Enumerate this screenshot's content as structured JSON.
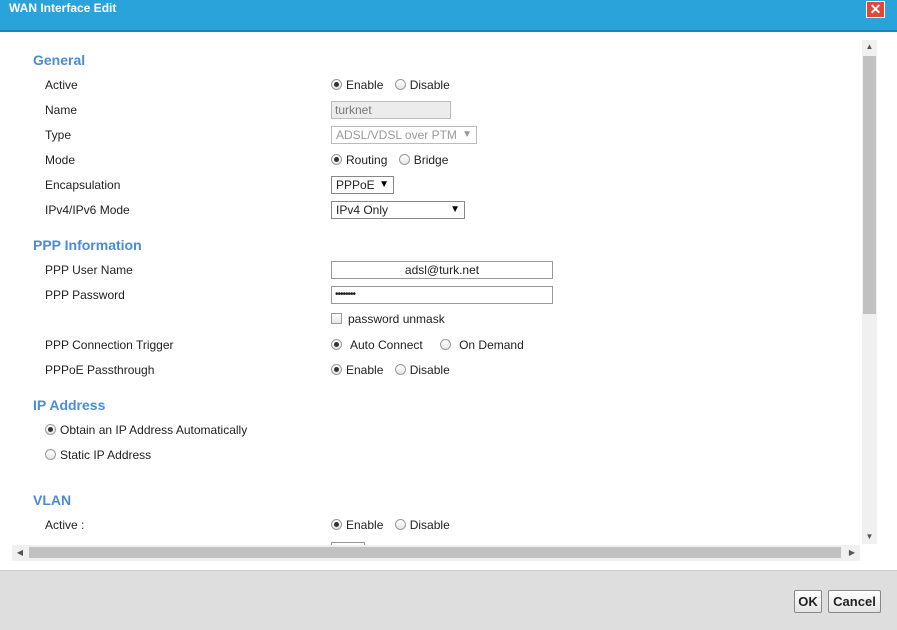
{
  "window": {
    "title": "WAN Interface Edit",
    "close_symbol": "✕"
  },
  "general": {
    "heading": "General",
    "active": {
      "label": "Active",
      "options": [
        "Enable",
        "Disable"
      ],
      "selected": "Enable"
    },
    "name": {
      "label": "Name",
      "value": "turknet"
    },
    "type": {
      "label": "Type",
      "value": "ADSL/VDSL over PTM"
    },
    "mode": {
      "label": "Mode",
      "options": [
        "Routing",
        "Bridge"
      ],
      "selected": "Routing"
    },
    "encapsulation": {
      "label": "Encapsulation",
      "value": "PPPoE"
    },
    "ip_mode": {
      "label": "IPv4/IPv6 Mode",
      "value": "IPv4 Only"
    }
  },
  "ppp": {
    "heading": "PPP Information",
    "username": {
      "label": "PPP User Name",
      "value": "adsl@turk.net"
    },
    "password": {
      "label": "PPP Password",
      "value": "••••••••"
    },
    "unmask_label": "password unmask",
    "trigger": {
      "label": "PPP Connection Trigger",
      "options": [
        "Auto Connect",
        "On Demand"
      ],
      "selected": "Auto Connect"
    },
    "passthrough": {
      "label": "PPPoE Passthrough",
      "options": [
        "Enable",
        "Disable"
      ],
      "selected": "Enable"
    }
  },
  "ip_address": {
    "heading": "IP Address",
    "options": [
      "Obtain an IP Address Automatically",
      "Static IP Address"
    ],
    "selected": "Obtain an IP Address Automatically"
  },
  "vlan": {
    "heading": "VLAN",
    "active": {
      "label": "Active :",
      "options": [
        "Enable",
        "Disable"
      ],
      "selected": "Enable"
    }
  },
  "footer": {
    "ok_label": "OK",
    "cancel_label": "Cancel"
  },
  "icons": {
    "dropdown_arrow": "▼",
    "scroll_up": "▲",
    "scroll_down": "▼",
    "scroll_left": "◀",
    "scroll_right": "▶"
  }
}
